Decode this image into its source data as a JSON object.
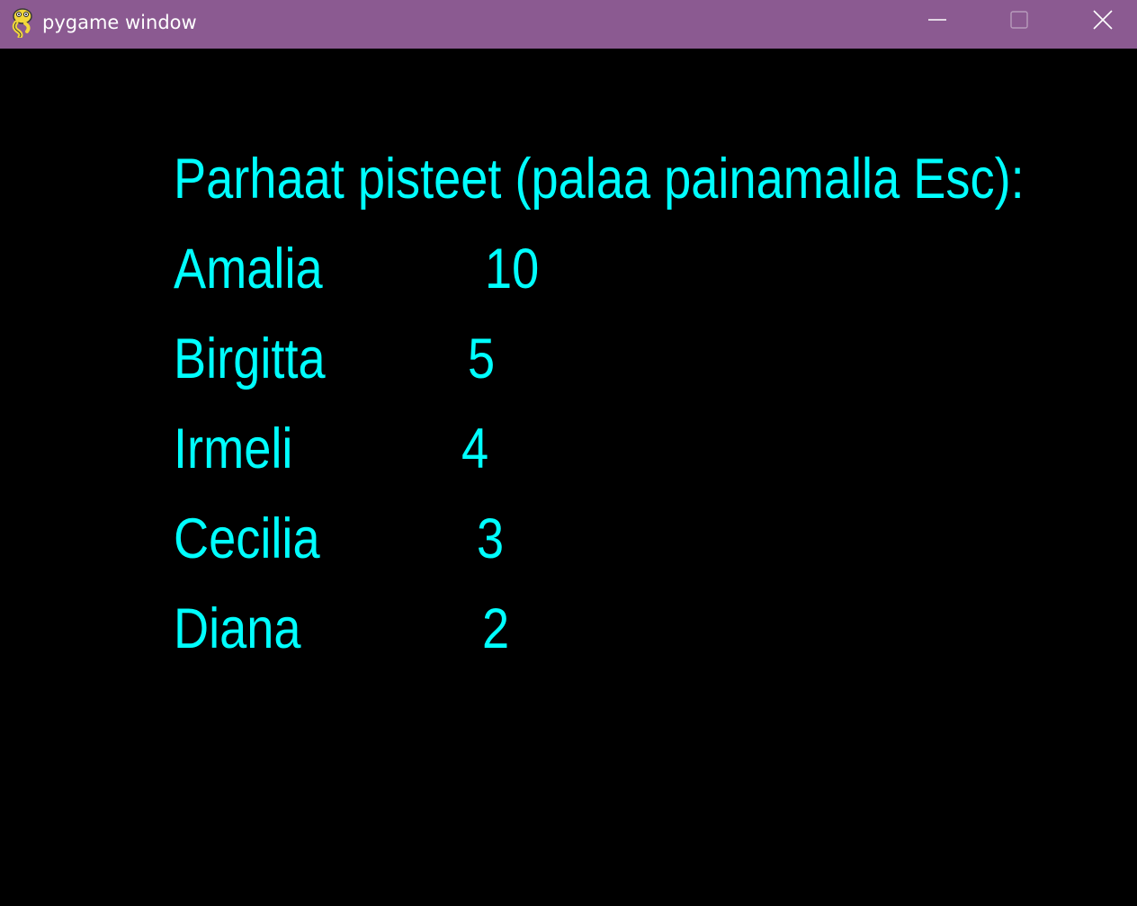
{
  "window": {
    "title": "pygame window",
    "icon": "pygame-snake-icon",
    "controls": [
      "minimize-icon",
      "maximize-icon",
      "close-icon"
    ],
    "titlebar_color": "#8b5a91"
  },
  "game": {
    "background": "#000000",
    "text_color": "#00ffff",
    "heading": "Parhaat pisteet (palaa painamalla Esc):",
    "scores": [
      {
        "name": "Amalia",
        "score": "10"
      },
      {
        "name": "Birgitta",
        "score": "5"
      },
      {
        "name": "Irmeli",
        "score": "4"
      },
      {
        "name": "Cecilia",
        "score": "3"
      },
      {
        "name": "Diana",
        "score": "2"
      }
    ]
  }
}
